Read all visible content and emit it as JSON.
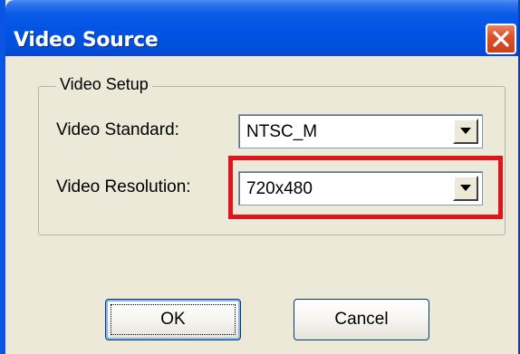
{
  "window": {
    "title": "Video Source"
  },
  "group": {
    "label": "Video Setup"
  },
  "fields": {
    "standard": {
      "label": "Video Standard:",
      "value": "NTSC_M"
    },
    "resolution": {
      "label": "Video Resolution:",
      "value": "720x480"
    }
  },
  "buttons": {
    "ok": "OK",
    "cancel": "Cancel"
  },
  "icons": {
    "close": "close-icon",
    "dropdown": "dropdown-arrow-icon"
  },
  "colors": {
    "titlebar": "#0053E3",
    "highlight": "#E0141B",
    "dialog_bg": "#ECE9D8"
  }
}
